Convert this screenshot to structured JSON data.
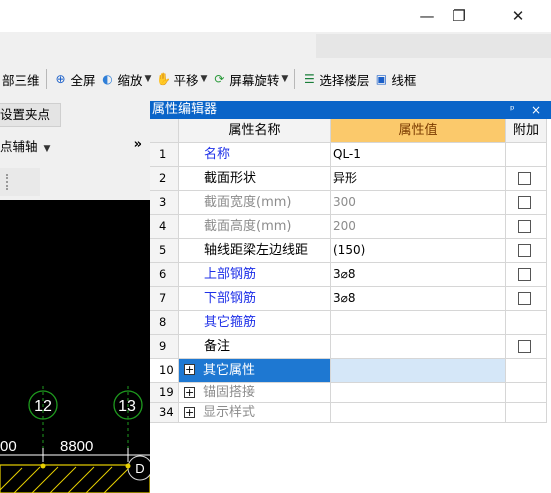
{
  "window": {
    "minimize_glyph": "—",
    "restore_glyph": "❐",
    "close_glyph": "✕"
  },
  "toolbar": {
    "items": [
      {
        "label": "部三维",
        "icon": "",
        "dropdown": false
      },
      {
        "label": "全屏",
        "icon": "⊕",
        "dropdown": false
      },
      {
        "label": "缩放",
        "icon": "◐",
        "dropdown": true
      },
      {
        "label": "平移",
        "icon": "✋",
        "dropdown": true
      },
      {
        "label": "屏幕旋转",
        "icon": "⟳",
        "dropdown": true
      },
      {
        "label": "选择楼层",
        "icon": "☰",
        "dropdown": false
      },
      {
        "label": "线框",
        "icon": "▣",
        "dropdown": false
      }
    ]
  },
  "left_panel": {
    "set_point_label": "设置夹点",
    "aux_axis_label": "点辅轴",
    "more_glyph": "»"
  },
  "canvas": {
    "axis_12": "12",
    "axis_13": "13",
    "dim_left": "00",
    "dim_right": "8800",
    "axis_d": "D"
  },
  "property_editor": {
    "title": "属性编辑器",
    "pin_glyph": "ᵖ",
    "close_glyph": "×",
    "columns": [
      "",
      "属性名称",
      "属性值",
      "附加"
    ],
    "rows": [
      {
        "num": "1",
        "name": "名称",
        "value": "QL-1",
        "style": "blue",
        "checkbox": false
      },
      {
        "num": "2",
        "name": "截面形状",
        "value": "异形",
        "style": "normal",
        "checkbox": true
      },
      {
        "num": "3",
        "name": "截面宽度(mm)",
        "value": "300",
        "style": "gray",
        "checkbox": true
      },
      {
        "num": "4",
        "name": "截面高度(mm)",
        "value": "200",
        "style": "gray",
        "checkbox": true
      },
      {
        "num": "5",
        "name": "轴线距梁左边线距",
        "value": "(150)",
        "style": "normal",
        "checkbox": true
      },
      {
        "num": "6",
        "name": "上部钢筋",
        "value": "3⌀8",
        "style": "blue",
        "checkbox": true
      },
      {
        "num": "7",
        "name": "下部钢筋",
        "value": "3⌀8",
        "style": "blue",
        "checkbox": true
      },
      {
        "num": "8",
        "name": "其它箍筋",
        "value": "",
        "style": "blue",
        "checkbox": false
      },
      {
        "num": "9",
        "name": "备注",
        "value": "",
        "style": "normal",
        "checkbox": true
      },
      {
        "num": "10",
        "name": "其它属性",
        "value": "",
        "style": "group-selected",
        "checkbox": false
      },
      {
        "num": "19",
        "name": "锚固搭接",
        "value": "",
        "style": "group",
        "checkbox": false
      },
      {
        "num": "34",
        "name": "显示样式",
        "value": "",
        "style": "group",
        "checkbox": false
      }
    ],
    "expander_glyph": "+"
  }
}
